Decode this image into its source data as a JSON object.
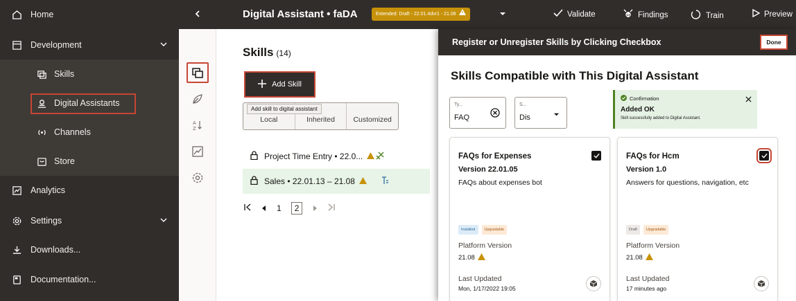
{
  "nav": {
    "items": [
      {
        "label": "Home",
        "icon": "home-icon"
      },
      {
        "label": "Development",
        "icon": "development-icon"
      },
      {
        "label": "Skills",
        "icon": "skills-icon"
      },
      {
        "label": "Digital Assistants",
        "icon": "digital-assistant-icon"
      },
      {
        "label": "Channels",
        "icon": "channels-icon"
      },
      {
        "label": "Store",
        "icon": "store-icon"
      },
      {
        "label": "Analytics",
        "icon": "analytics-icon"
      },
      {
        "label": "Settings",
        "icon": "settings-icon"
      },
      {
        "label": "Downloads...",
        "icon": "downloads-icon"
      },
      {
        "label": "Documentation...",
        "icon": "documentation-icon"
      }
    ]
  },
  "header": {
    "title": "Digital Assistant • faDA",
    "status_badge": "Extended: Draft - 22.01.4dvr1 - 21.08",
    "actions": {
      "validate": "Validate",
      "findings": "Findings",
      "train": "Train",
      "preview": "Preview"
    }
  },
  "skills": {
    "title": "Skills",
    "count": "(14)",
    "add_skill_label": "Add Skill",
    "tooltip": "Add skill to digital assistant",
    "filters": [
      "Local",
      "Inherited",
      "Customized"
    ],
    "rows": [
      {
        "label": "Project Time Entry • 22.0..."
      },
      {
        "label": "Sales • 22.01.13 – 21.08"
      }
    ],
    "pager": {
      "pages": [
        "1",
        "2"
      ]
    }
  },
  "register": {
    "title": "Register or Unregister Skills by Clicking Checkbox",
    "done_label": "Done",
    "heading": "Skills Compatible with This Digital Assistant",
    "filter_type": {
      "label": "Ty...",
      "value": "FAQ"
    },
    "filter_status": {
      "label": "S...",
      "value": "Dis"
    },
    "toast": {
      "title": "Confirmation",
      "message": "Added OK",
      "detail": "Skill successfully added to Digital Assistant."
    },
    "cards": [
      {
        "title": "FAQs for Expenses",
        "version": "Version 22.01.05",
        "description": "FAQs about expenses bot",
        "badges": [
          "Installed",
          "Upgradable"
        ],
        "platform_label": "Platform Version",
        "platform_value": "21.08",
        "updated_label": "Last Updated",
        "updated_value": "Mon, 1/17/2022 19:05"
      },
      {
        "title": "FAQs for Hcm",
        "version": "Version 1.0",
        "description": "Answers for questions, navigation, etc",
        "badges": [
          "Draft",
          "Upgradable"
        ],
        "platform_label": "Platform Version",
        "platform_value": "21.08",
        "updated_label": "Last Updated",
        "updated_value": "17 minutes ago"
      }
    ]
  },
  "colors": {
    "dark_bg": "#312d2a",
    "highlight_red": "#c74634",
    "warning": "#c7920a",
    "success": "#508223"
  }
}
